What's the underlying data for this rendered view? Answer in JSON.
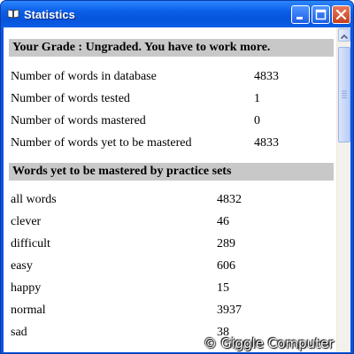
{
  "window": {
    "title": "Statistics",
    "title_icon": "open-book-icon",
    "buttons": [
      "minimize-icon",
      "maximize-icon",
      "close-icon"
    ]
  },
  "grade_section": {
    "header": "Your Grade : Ungraded. You have to work more.",
    "rows": [
      {
        "label": "Number of words in database",
        "value": "4833"
      },
      {
        "label": "Number of words tested",
        "value": "1"
      },
      {
        "label": "Number of words mastered",
        "value": "0"
      },
      {
        "label": "Number of words yet to be mastered",
        "value": "4833"
      }
    ]
  },
  "practice_section": {
    "header": "Words yet to be mastered by practice sets",
    "rows": [
      {
        "label": "all words",
        "value": "4832"
      },
      {
        "label": "clever",
        "value": "46"
      },
      {
        "label": "difficult",
        "value": "289"
      },
      {
        "label": "easy",
        "value": "606"
      },
      {
        "label": "happy",
        "value": "15"
      },
      {
        "label": "normal",
        "value": "3937"
      },
      {
        "label": "sad",
        "value": "38"
      }
    ]
  },
  "watermark": "© Giggle Computer",
  "colors": {
    "titlebar": "#0a5ee8",
    "close_button": "#d2502f",
    "section_header": "#c8c8c8"
  }
}
